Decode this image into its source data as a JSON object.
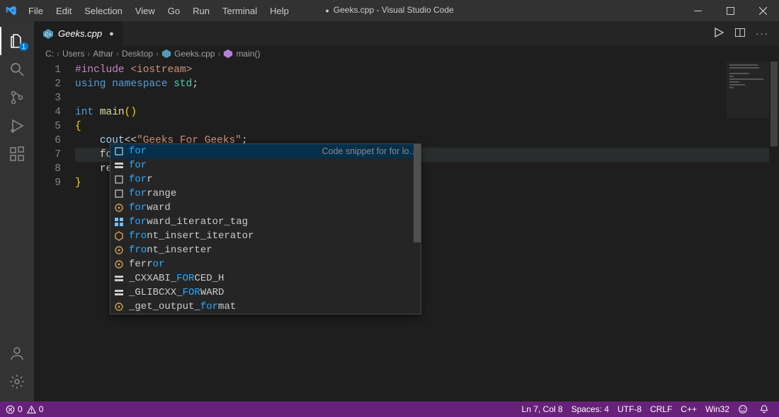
{
  "title": {
    "filename": "Geeks.cpp",
    "app": "Visual Studio Code"
  },
  "menu": [
    "File",
    "Edit",
    "Selection",
    "View",
    "Go",
    "Run",
    "Terminal",
    "Help"
  ],
  "activity": {
    "explorer_badge": "1"
  },
  "tab": {
    "label": "Geeks.cpp"
  },
  "breadcrumbs": {
    "items": [
      "C:",
      "Users",
      "Athar",
      "Desktop",
      "Geeks.cpp",
      "main()"
    ]
  },
  "code": {
    "lines": [
      {
        "n": "1",
        "segments": [
          {
            "t": "#include ",
            "c": "tok-pre"
          },
          {
            "t": "<iostream>",
            "c": "tok-str"
          }
        ]
      },
      {
        "n": "2",
        "segments": [
          {
            "t": "using ",
            "c": "tok-kw"
          },
          {
            "t": "namespace ",
            "c": "tok-kw"
          },
          {
            "t": "std",
            "c": "tok-ns"
          },
          {
            "t": ";",
            "c": "tok-punc"
          }
        ]
      },
      {
        "n": "3",
        "segments": []
      },
      {
        "n": "4",
        "segments": [
          {
            "t": "int ",
            "c": "tok-type"
          },
          {
            "t": "main",
            "c": "tok-func"
          },
          {
            "t": "()",
            "c": "tok-gold"
          }
        ]
      },
      {
        "n": "5",
        "segments": [
          {
            "t": "{",
            "c": "tok-gold"
          }
        ]
      },
      {
        "n": "6",
        "segments": [
          {
            "t": "    ",
            "c": ""
          },
          {
            "t": "cout",
            "c": "tok-ident"
          },
          {
            "t": "<<",
            "c": "tok-punc"
          },
          {
            "t": "\"Geeks For Geeks\"",
            "c": "tok-str"
          },
          {
            "t": ";",
            "c": "tok-punc"
          }
        ]
      },
      {
        "n": "7",
        "current": true,
        "segments": [
          {
            "t": "    ",
            "c": ""
          },
          {
            "t": "for",
            "c": "tok-punc"
          }
        ],
        "cursor": true
      },
      {
        "n": "8",
        "segments": [
          {
            "t": "    ",
            "c": ""
          },
          {
            "t": "ret",
            "c": "tok-punc"
          }
        ]
      },
      {
        "n": "9",
        "segments": [
          {
            "t": "}",
            "c": "tok-gold"
          }
        ]
      }
    ]
  },
  "suggest": {
    "detail_first": "Code snippet for for lo…",
    "items": [
      {
        "icon": "square",
        "pre": "",
        "hl": "for",
        "post": "",
        "sel": true
      },
      {
        "icon": "const",
        "pre": "",
        "hl": "for",
        "post": ""
      },
      {
        "icon": "square",
        "pre": "",
        "hl": "for",
        "post": "r"
      },
      {
        "icon": "square",
        "pre": "",
        "hl": "for",
        "post": "range"
      },
      {
        "icon": "class",
        "pre": "",
        "hl": "for",
        "post": "ward"
      },
      {
        "icon": "struct",
        "pre": "",
        "hl": "for",
        "post": "ward_iterator_tag"
      },
      {
        "icon": "class2",
        "pre": "",
        "hl": "fro",
        "post": "nt_insert_iterator"
      },
      {
        "icon": "class",
        "pre": "",
        "hl": "fro",
        "post": "nt_inserter"
      },
      {
        "icon": "class",
        "pre": "f",
        "hl": "",
        "post": "err",
        "hl2": "or"
      },
      {
        "icon": "const",
        "pre": "_CXXABI_",
        "hl": "FOR",
        "post": "CED_H"
      },
      {
        "icon": "const",
        "pre": "_GLIBCXX_",
        "hl": "FOR",
        "post": "WARD"
      },
      {
        "icon": "class",
        "pre": "_get_output_",
        "hl": "for",
        "post": "mat"
      }
    ]
  },
  "status": {
    "errors": "0",
    "warnings": "0",
    "ln_col": "Ln 7, Col 8",
    "spaces": "Spaces: 4",
    "encoding": "UTF-8",
    "eol": "CRLF",
    "lang": "C++",
    "target": "Win32"
  }
}
